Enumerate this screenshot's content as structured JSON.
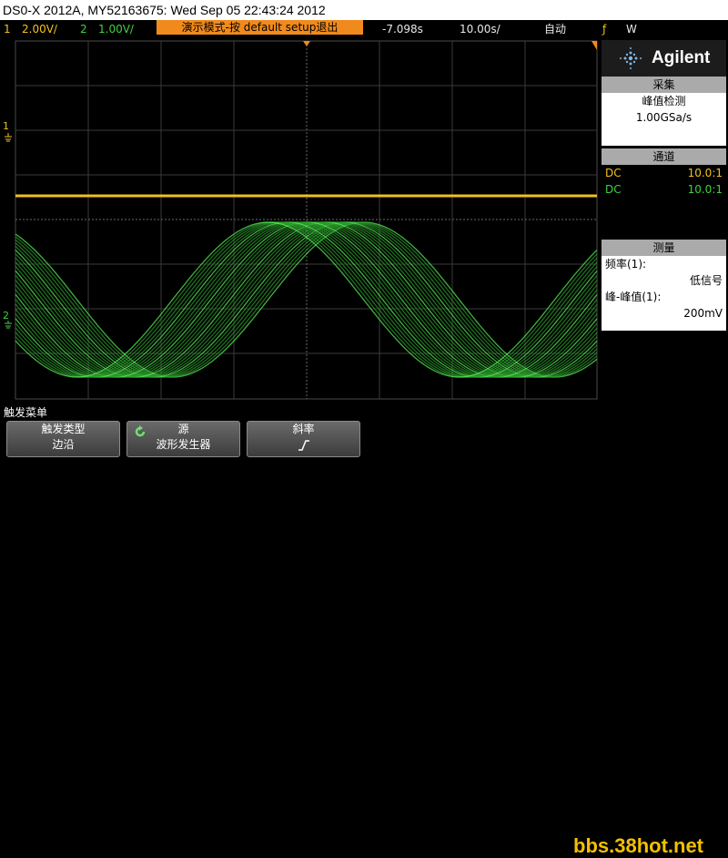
{
  "title": "DS0-X 2012A, MY52163675: Wed Sep 05 22:43:24 2012",
  "status": {
    "ch1_num": "1",
    "ch1_scale": "2.00V/",
    "ch2_num": "2",
    "ch2_scale": "1.00V/",
    "demo_banner": "演示模式-按 default setup退出",
    "time_offset": "-7.098s",
    "time_scale": "10.00s/",
    "trigger_mode": "自动",
    "trigger_channel": "W"
  },
  "brand": "Agilent",
  "acquire": {
    "header": "采集",
    "mode": "峰值检测",
    "rate": "1.00GSa/s"
  },
  "channels": {
    "header": "通道",
    "rows": [
      {
        "coupling": "DC",
        "ratio": "10.0:1"
      },
      {
        "coupling": "DC",
        "ratio": "10.0:1"
      }
    ]
  },
  "measure": {
    "header": "测量",
    "label1": "频率(1):",
    "value1": "低信号",
    "label2": "峰-峰值(1):",
    "value2": "200mV"
  },
  "markers": {
    "ch1": "1",
    "ch2": "2"
  },
  "softkeys": {
    "menu_title": "触发菜单",
    "key1_label": "触发类型",
    "key1_value": "边沿",
    "key2_label": "源",
    "key2_value": "波形发生器",
    "key3_label": "斜率",
    "key3_value": "↑"
  },
  "watermark": "bbs.38hot.net",
  "colors": {
    "ch1": "#f0c020",
    "ch2": "#40d040",
    "demo": "#f08a1c"
  }
}
